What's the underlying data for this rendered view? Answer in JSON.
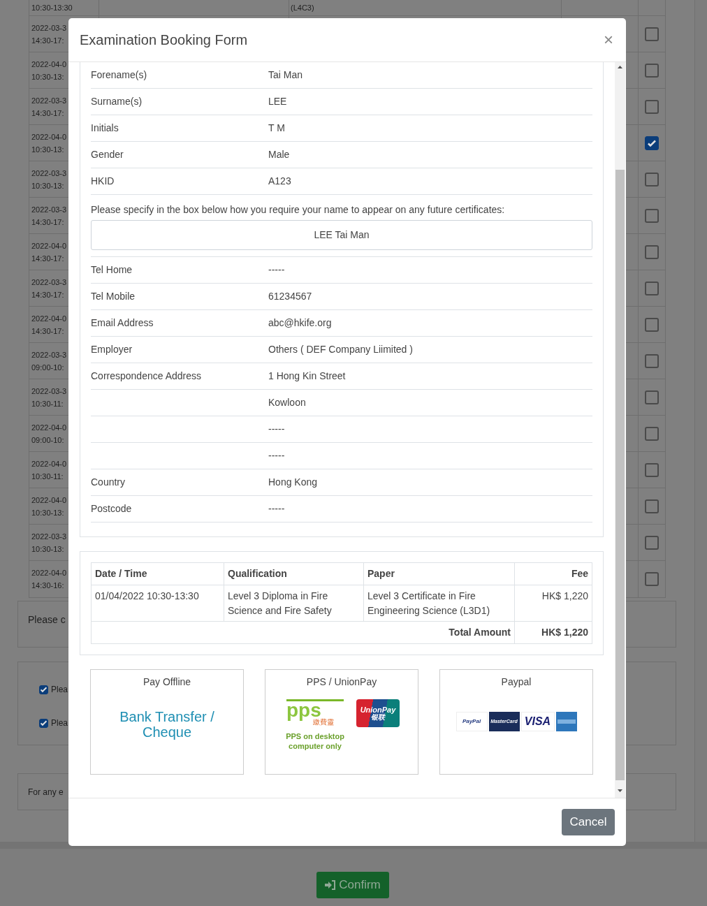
{
  "background": {
    "top_row": {
      "time": "10:30-13:30",
      "column_2": "(L4C3)"
    },
    "rows": [
      {
        "date": "2022-03-3",
        "time": "14:30-17:",
        "checked": false
      },
      {
        "date": "2022-04-0",
        "time": "10:30-13:",
        "checked": false
      },
      {
        "date": "2022-03-3",
        "time": "14:30-17:",
        "checked": false
      },
      {
        "date": "2022-04-0",
        "time": "10:30-13:",
        "checked": true
      },
      {
        "date": "2022-03-3",
        "time": "10:30-13:",
        "checked": false
      },
      {
        "date": "2022-03-3",
        "time": "14:30-17:",
        "checked": false
      },
      {
        "date": "2022-04-0",
        "time": "14:30-17:",
        "checked": false
      },
      {
        "date": "2022-03-3",
        "time": "14:30-17:",
        "checked": false
      },
      {
        "date": "2022-04-0",
        "time": "14:30-17:",
        "checked": false
      },
      {
        "date": "2022-03-3",
        "time": "09:00-10:",
        "checked": false
      },
      {
        "date": "2022-03-3",
        "time": "10:30-11:",
        "checked": false
      },
      {
        "date": "2022-04-0",
        "time": "09:00-10:",
        "checked": false
      },
      {
        "date": "2022-04-0",
        "time": "10:30-11:",
        "checked": false
      },
      {
        "date": "2022-04-0",
        "time": "10:30-13:",
        "checked": false
      },
      {
        "date": "2022-03-3",
        "time": "10:30-13:",
        "checked": false
      },
      {
        "date": "2022-04-0",
        "time": "14:30-16:",
        "checked": false
      }
    ],
    "note": "Please c",
    "agreements": [
      {
        "label": "Plea",
        "checked": true
      },
      {
        "label": "Plea",
        "checked": true
      }
    ],
    "contact_note": "For any e",
    "confirm_button": "Confirm"
  },
  "modal": {
    "title": "Examination Booking Form",
    "close": "×",
    "fields_before": [
      {
        "label": "Forename(s)",
        "value": "Tai Man"
      },
      {
        "label": "Surname(s)",
        "value": "LEE"
      },
      {
        "label": "Initials",
        "value": "T M"
      },
      {
        "label": "Gender",
        "value": "Male"
      },
      {
        "label": "HKID",
        "value": "A123"
      }
    ],
    "certificate_prompt": "Please specify in the box below how you require your name to appear on any future certificates:",
    "certificate_name": "LEE Tai Man",
    "fields_after": [
      {
        "label": "Tel Home",
        "value": "-----"
      },
      {
        "label": "Tel Mobile",
        "value": "61234567"
      },
      {
        "label": "Email Address",
        "value": "abc@hkife.org"
      },
      {
        "label": "Employer",
        "value": "Others ( DEF Company Liimited )"
      },
      {
        "label": "Correspondence Address",
        "value": "1 Hong Kin Street"
      },
      {
        "value": "Kowloon"
      },
      {
        "value": "-----"
      },
      {
        "value": "-----"
      },
      {
        "label": "Country",
        "value": "Hong Kong"
      },
      {
        "label": "Postcode",
        "value": "-----"
      }
    ],
    "fee_table": {
      "columns": [
        "Date / Time",
        "Qualification",
        "Paper",
        "Fee"
      ],
      "rows": [
        [
          "01/04/2022 10:30-13:30",
          "Level 3 Diploma in Fire Science and Fire Safety",
          "Level 3 Certificate in Fire Engineering Science (L3D1)",
          "HK$ 1,220"
        ]
      ],
      "total_label": "Total Amount",
      "total_value": "HK$ 1,220"
    },
    "payment_options": [
      {
        "kind": "offline",
        "title": "Pay Offline",
        "text": "Bank Transfer / Cheque"
      },
      {
        "kind": "pps",
        "title": "PPS / UnionPay",
        "pps_wordmark": "pps",
        "pps_chinese": "繳費靈",
        "note": "PPS on desktop computer only",
        "unionpay_wordmark": "UnionPay",
        "unionpay_chinese": "银联"
      },
      {
        "kind": "paypal",
        "title": "Paypal",
        "cards": [
          "PayPal",
          "MasterCard",
          "VISA"
        ]
      }
    ],
    "cancel_button": "Cancel"
  }
}
